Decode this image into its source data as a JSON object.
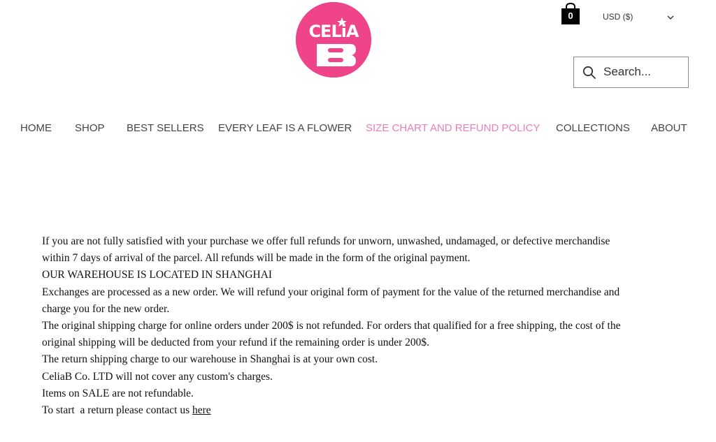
{
  "brand": {
    "logo_text": "CELiA",
    "logo_color": "#f0448a"
  },
  "header": {
    "cart_count": "0",
    "currency_label": "USD ($)",
    "search_placeholder": "Search..."
  },
  "nav": {
    "active_color": "#e77fb9",
    "items": [
      {
        "label": "HOME"
      },
      {
        "label": "SHOP"
      },
      {
        "label": "BEST SELLERS"
      },
      {
        "label": "EVERY LEAF IS A FLOWER"
      },
      {
        "label": "SIZE CHART AND REFUND POLICY",
        "active": true
      },
      {
        "label": "COLLECTIONS"
      },
      {
        "label": "ABOUT"
      }
    ]
  },
  "policy": {
    "para_1": "If you are not fully satisfied with your purchase we offer full refunds for unworn, unwashed, undamaged, or defective merchandise within 7 days of arrival of the parcel. All refunds will be made in the form of the original payment.",
    "para_2": "OUR WAREHOUSE IS LOCATED IN SHANGHAI",
    "para_3": "Exchanges are processed as a new order. We will refund your original form of payment for the value of the returned merchandise and charge you for the new order.",
    "para_4": "The original shipping charge for online orders under 200$ is not refunded. For orders that qualified for a free shipping, the cost of the original shipping will be deducted from your refund if the remaining order is under 200$.",
    "para_5": "The return shipping charge to our warehouse in Shanghai is at your own cost.",
    "para_6": "CeliaB Co. LTD will not cover any custom's charges.",
    "para_7": "Items on SALE are not refundable.",
    "contact_prefix": "To start  a return please contact us ",
    "contact_link": "here"
  }
}
